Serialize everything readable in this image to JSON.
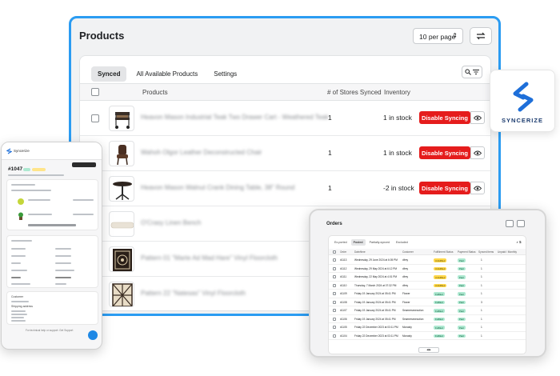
{
  "main": {
    "title": "Products",
    "per_page": "10 per page",
    "tabs": [
      {
        "label": "Synced",
        "active": true
      },
      {
        "label": "All Available Products",
        "active": false
      },
      {
        "label": "Settings",
        "active": false
      }
    ],
    "columns": {
      "products": "Products",
      "stores": "# of Stores Synced",
      "inventory": "Inventory"
    },
    "rows": [
      {
        "name": "Heavon Mason Industrial Teak Two Drawer Cart - Weathered Teak",
        "stores": "1",
        "stock": "1 in stock",
        "action": "Disable Syncing",
        "thumb": "cart"
      },
      {
        "name": "Wahoh Olgor Leather Deconstructed Chair",
        "stores": "1",
        "stock": "1 in stock",
        "action": "Disable Syncing",
        "thumb": "chair"
      },
      {
        "name": "Heavon Mason Walnut Crank Dining Table, 38\" Round",
        "stores": "1",
        "stock": "-2 in stock",
        "action": "Disable Syncing",
        "thumb": "table"
      },
      {
        "name": "O'Crasy Linen Bench",
        "stores": "",
        "stock": "",
        "action": "",
        "thumb": "bench"
      },
      {
        "name": "Pattern 01 \"Marte Ad Mad Hare\" Vinyl Floorcloth",
        "stores": "",
        "stock": "",
        "action": "",
        "thumb": "rug1"
      },
      {
        "name": "Pattern 22 \"Natesas\" Vinyl Floorcloth",
        "stores": "",
        "stock": "",
        "action": "",
        "thumb": "rug2"
      }
    ]
  },
  "logo": {
    "text": "SYNCERIZE",
    "color": "#1e6fd9"
  },
  "phone": {
    "brand": "Syncerize",
    "order_number": "#1047",
    "customer_label": "Customer",
    "shipping_label": "Shipping address",
    "support_text": "For technical help or support: Get Support"
  },
  "tablet": {
    "title": "Orders",
    "tabs": [
      {
        "label": "Ex-ported",
        "active": false
      },
      {
        "label": "Posted",
        "active": true
      },
      {
        "label": "Partially-synced",
        "active": false
      },
      {
        "label": "Excluded",
        "active": false
      }
    ],
    "columns": [
      "Order",
      "Date/time",
      "Customer",
      "Fulfillment Status",
      "Payment Status",
      "Synced items",
      "Unpaid / Monthly"
    ],
    "rows": [
      {
        "order": "#1113",
        "date": "Wednesday, 29 June 2024 at 6:05 PM",
        "customer": "dfrey",
        "fulfillment": "Unfulfilled",
        "payment": "Paid",
        "synced": "1"
      },
      {
        "order": "#1112",
        "date": "Wednesday, 29 May 2024 at 6:12 PM",
        "customer": "dfrey",
        "fulfillment": "Unfulfilled",
        "payment": "Paid",
        "synced": "1"
      },
      {
        "order": "#1111",
        "date": "Wednesday, 22 May 2024 at 4:01 PM",
        "customer": "dfrey",
        "fulfillment": "Unfulfilled",
        "payment": "Paid",
        "synced": "1"
      },
      {
        "order": "#1110",
        "date": "Thursday, 7 March 2024 at 07:32 PM",
        "customer": "dfrey",
        "fulfillment": "Unfulfilled",
        "payment": "Paid",
        "synced": "1"
      },
      {
        "order": "#1109",
        "date": "Friday 19 January 2024 at 05:41 PM",
        "customer": "Flower",
        "fulfillment": "Fulfilled",
        "payment": "Paid",
        "synced": "1"
      },
      {
        "order": "#1108",
        "date": "Friday 19 January 2024 at 05:41 PM",
        "customer": "Flower",
        "fulfillment": "Fulfilled",
        "payment": "Paid",
        "synced": "3"
      },
      {
        "order": "#1107",
        "date": "Friday 19 January 2024 at 05:41 PM",
        "customer": "Seamersexecution",
        "fulfillment": "Fulfilled",
        "payment": "Paid",
        "synced": "1"
      },
      {
        "order": "#1106",
        "date": "Friday 19 January 2024 at 05:41 PM",
        "customer": "Seamersexecution",
        "fulfillment": "Fulfilled",
        "payment": "Paid",
        "synced": "1"
      },
      {
        "order": "#1105",
        "date": "Friday 22 December 2023 at 03:11 PM",
        "customer": "Mcnasty",
        "fulfillment": "Fulfilled",
        "payment": "Paid",
        "synced": "1"
      },
      {
        "order": "#1104",
        "date": "Friday 22 December 2023 at 03:11 PM",
        "customer": "Mcnasty",
        "fulfillment": "Fulfilled",
        "payment": "Paid",
        "synced": "1"
      }
    ]
  }
}
